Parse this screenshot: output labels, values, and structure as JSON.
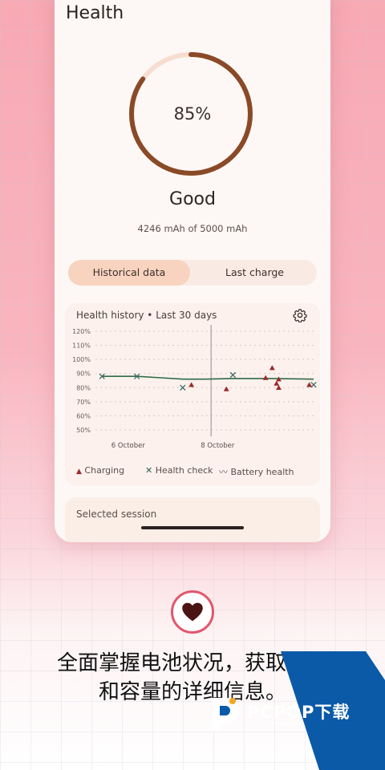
{
  "screen": {
    "title": "Health",
    "health_percent_label": "85%",
    "health_percent": 85,
    "status": "Good",
    "capacity_text": "4246 mAh of 5000 mAh"
  },
  "tabs": [
    {
      "label": "Historical data",
      "active": true
    },
    {
      "label": "Last charge",
      "active": false
    }
  ],
  "history_card": {
    "title": "Health history • Last 30 days",
    "gear_icon": "gear-icon"
  },
  "chart_data": {
    "type": "scatter",
    "y_ticks": [
      "120%",
      "110%",
      "100%",
      "90%",
      "80%",
      "70%",
      "60%",
      "50%"
    ],
    "ylim": [
      50,
      120
    ],
    "x_ticks": [
      "6 October",
      "8 October"
    ],
    "legend": [
      {
        "label": "Charging",
        "marker": "triangle",
        "color": "#9b2a2a"
      },
      {
        "label": "Health check",
        "marker": "x",
        "color": "#2e5e4e"
      },
      {
        "label": "Battery health",
        "marker": "line",
        "color": "#2f6b47"
      }
    ],
    "series": [
      {
        "name": "Charging",
        "points": [
          [
            0.44,
            82
          ],
          [
            0.6,
            79
          ],
          [
            0.78,
            87
          ],
          [
            0.81,
            94
          ],
          [
            0.83,
            83
          ],
          [
            0.84,
            86
          ],
          [
            0.84,
            80
          ],
          [
            0.98,
            82
          ]
        ]
      },
      {
        "name": "Health check",
        "points": [
          [
            0.03,
            88
          ],
          [
            0.19,
            88
          ],
          [
            0.4,
            80
          ],
          [
            0.63,
            89
          ],
          [
            1.0,
            82
          ]
        ]
      },
      {
        "name": "Battery health",
        "points": [
          [
            0.03,
            88
          ],
          [
            0.19,
            88
          ],
          [
            0.3,
            87
          ],
          [
            0.4,
            86
          ],
          [
            0.5,
            86
          ],
          [
            0.63,
            86.5
          ],
          [
            0.8,
            86.5
          ],
          [
            1.0,
            86
          ]
        ]
      }
    ]
  },
  "selected_session": {
    "label": "Selected session"
  },
  "promo": {
    "heart_icon": "heart-icon",
    "line1": "全面掌握电池状况，获取健康",
    "line2": "和容量的详细信息。"
  },
  "watermark": {
    "text": "PCPOP下载",
    "sub": "PCPOP Download",
    "colors": {
      "blue": "#0a5aa8",
      "orange": "#f5a623"
    }
  }
}
